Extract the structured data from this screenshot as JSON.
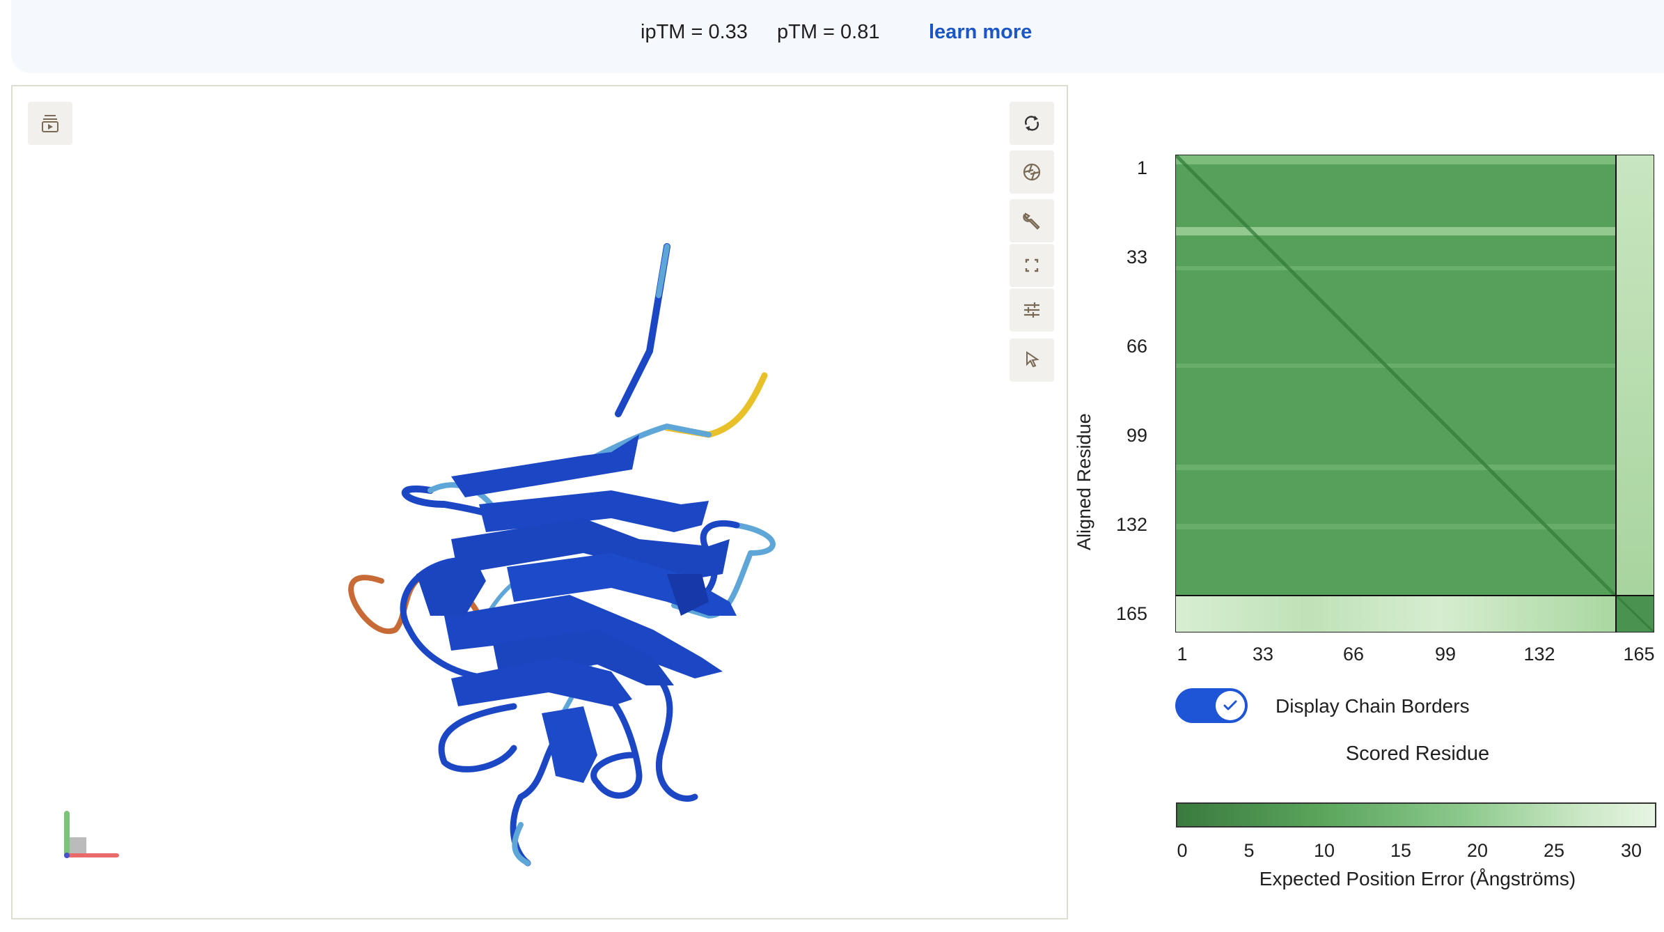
{
  "header": {
    "iptm": "ipTM = 0.33",
    "ptm": "pTM = 0.81",
    "learn_more": "learn more"
  },
  "viewer": {
    "left_tool": "playback-icon",
    "right_tools": [
      "rotate-icon",
      "camera-icon",
      "wrench-icon",
      "fullscreen-icon",
      "sliders-icon",
      "pointer-icon"
    ]
  },
  "pae_plot": {
    "y_axis_title": "Aligned Residue",
    "x_axis_title": "Scored Residue",
    "y_ticks": [
      "1",
      "33",
      "66",
      "99",
      "132",
      "165"
    ],
    "x_ticks": [
      "1",
      "33",
      "66",
      "99",
      "132",
      "165"
    ],
    "toggle_label": "Display Chain Borders",
    "toggle_on": true,
    "colorbar_ticks": [
      "0",
      "5",
      "10",
      "15",
      "20",
      "25",
      "30"
    ],
    "colorbar_title": "Expected Position Error (Ångströms)",
    "colors": {
      "low": "#3a7a3e",
      "high": "#e7f5e3",
      "accent": "#1d55d6"
    }
  }
}
